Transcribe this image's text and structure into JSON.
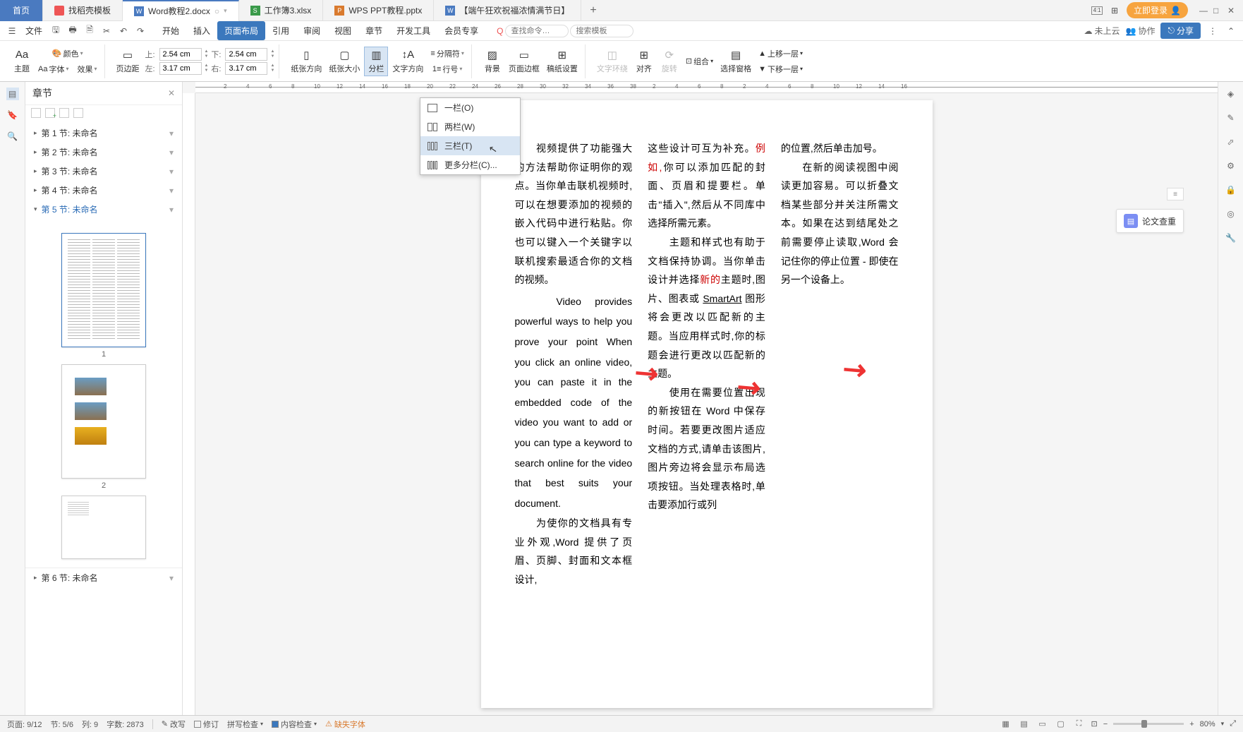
{
  "tabs": {
    "home": "首页",
    "items": [
      {
        "icon": "template",
        "label": "找稻壳模板",
        "color": "#e55"
      },
      {
        "icon": "word",
        "label": "Word教程2.docx",
        "color": "#4a7ac0",
        "active": true,
        "dirty": true
      },
      {
        "icon": "excel",
        "label": "工作簿3.xlsx",
        "color": "#3a9a4a"
      },
      {
        "icon": "ppt",
        "label": "WPS PPT教程.pptx",
        "color": "#d97a2e"
      },
      {
        "icon": "word",
        "label": "【端午狂欢祝福浓情满节日】",
        "color": "#4a7ac0"
      }
    ]
  },
  "header_right": {
    "login": "立即登录"
  },
  "menu": {
    "file": "文件",
    "items": [
      "开始",
      "插入",
      "页面布局",
      "引用",
      "审阅",
      "视图",
      "章节",
      "开发工具",
      "会员专享"
    ],
    "active_index": 2,
    "search_placeholder": "查找命令…",
    "template_placeholder": "搜索模板",
    "cloud": "未上云",
    "coop": "协作",
    "share": "分享"
  },
  "ribbon": {
    "theme": "主题",
    "font": "字体",
    "color": "颜色",
    "effect": "效果",
    "margin": "页边距",
    "top": "上:",
    "top_v": "2.54 cm",
    "bottom": "下:",
    "bottom_v": "2.54 cm",
    "left": "左:",
    "left_v": "3.17 cm",
    "right": "右:",
    "right_v": "3.17 cm",
    "orient": "纸张方向",
    "size": "纸张大小",
    "columns": "分栏",
    "textdir": "文字方向",
    "lineno": "行号",
    "hyphen": "分隔符",
    "bg": "背景",
    "border": "页面边框",
    "water": "稿纸设置",
    "wrap": "文字环绕",
    "align": "对齐",
    "rotate": "旋转",
    "group": "组合",
    "selpane": "选择窗格",
    "up": "上移一层",
    "down": "下移一层"
  },
  "panel": {
    "title": "章节",
    "sections": [
      "第 1 节: 未命名",
      "第 2 节: 未命名",
      "第 3 节: 未命名",
      "第 4 节: 未命名",
      "第 5 节: 未命名",
      "第 6 节: 未命名"
    ],
    "active_section": 4,
    "thumb_labels": [
      "1",
      "2"
    ]
  },
  "columns_menu": [
    {
      "cols": 1,
      "label": "一栏(O)"
    },
    {
      "cols": 2,
      "label": "两栏(W)"
    },
    {
      "cols": 3,
      "label": "三栏(T)",
      "hover": true
    },
    {
      "cols": 0,
      "label": "更多分栏(C)..."
    }
  ],
  "ruler_h": [
    "2",
    "4",
    "6",
    "8",
    "10",
    "12",
    "14",
    "16",
    "18",
    "20",
    "22",
    "24",
    "26",
    "28",
    "30",
    "32",
    "34",
    "36",
    "38",
    "2",
    "4",
    "6",
    "8",
    "2",
    "4",
    "6",
    "8",
    "10",
    "12",
    "14",
    "16"
  ],
  "doc": {
    "col1": "　　视频提供了功能强大的方法帮助你证明你的观点。当你单击联机视频时,可以在想要添加的视频的嵌入代码中进行粘贴。你也可以键入一个关键字以联机搜索最适合你的文档的视频。",
    "col1_en": "Video provides powerful ways to help you prove your point When you click an online video, you can paste it in the embedded code of the video you want to add or you can type a keyword to search online for the video that best suits your document.",
    "col1b": "　　为使你的文档具有专业外观,Word 提供了页眉、页脚、封面和文本框设计,",
    "col2a": "这些设计可互为补充。",
    "col2_eg": "例如,",
    "col2b": "你可以添加匹配的封面、页眉和提要栏。单击\"插入\",然后从不同库中选择所需元素。",
    "col2c": "　　主题和样式也有助于文档保持协调。当你单击设计并选择",
    "col2_new": "新的",
    "col2d": "主题时,图片、图表或 ",
    "col2_sm": "SmartArt",
    "col2e": " 图形将会更改以匹配新的主题。当应用样式时,你的标题会进行更改以匹配新的主题。",
    "col2f": "　　使用在需要位置出现的新按钮在 Word 中保存时间。若要更改图片适应文档的方式,请单击该图片,图片旁边将会显示布局选项按钮。当处理表格时,单击要添加行或列",
    "col3a": "的位置,然后单击加号。",
    "col3b": "　　在新的阅读视图中阅读更加容易。可以折叠文档某些部分并关注所需文本。如果在达到结尾处之前需要停止读取,Word 会记住你的停止位置 - 即使在另一个设备上。"
  },
  "paper_check": "论文查重",
  "status": {
    "page": "页面: 9/12",
    "sec": "节: 5/6",
    "col": "列: 9",
    "words": "字数: 2873",
    "edit": "改写",
    "revise": "修订",
    "spell": "拼写检查",
    "content": "内容检查",
    "font_miss": "缺失字体",
    "zoom": "80%"
  }
}
